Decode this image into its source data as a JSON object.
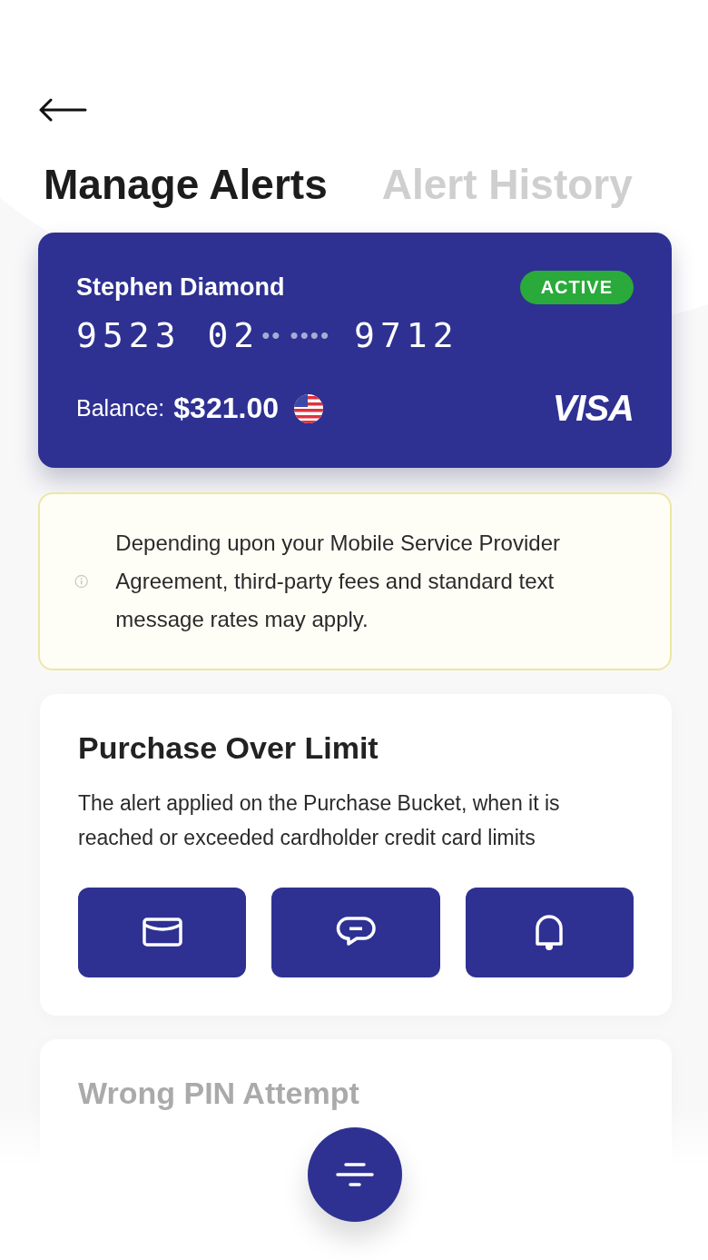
{
  "tabs": [
    {
      "label": "Manage Alerts",
      "selected": true
    },
    {
      "label": "Alert History",
      "selected": false
    }
  ],
  "card": {
    "holder": "Stephen Diamond",
    "status": "ACTIVE",
    "number_start": "9523 02",
    "number_mask": "•• ••••",
    "number_end": "9712",
    "balance_label": "Balance:",
    "balance": "$321.00",
    "network": "VISA"
  },
  "notice": {
    "text": "Depending upon your Mobile Service Provider Agreement, third-party fees and standard text message rates may apply."
  },
  "alerts": [
    {
      "title": "Purchase Over Limit",
      "description": "The alert applied on the Purchase Bucket, when it is reached or exceeded cardholder credit card limits",
      "channels": [
        {
          "kind": "email"
        },
        {
          "kind": "sms"
        },
        {
          "kind": "push"
        }
      ]
    },
    {
      "title": "Wrong PIN Attempt"
    }
  ]
}
